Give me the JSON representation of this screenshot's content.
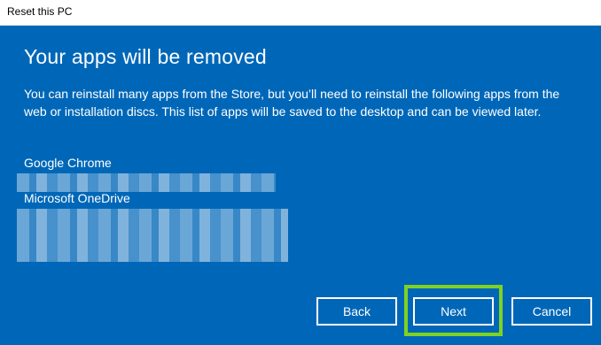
{
  "window": {
    "title": "Reset this PC"
  },
  "dialog": {
    "heading": "Your apps will be removed",
    "description": "You can reinstall many apps from the Store, but you’ll need to reinstall the following apps from the web or installation discs. This list of apps will be saved to the desktop and can be viewed later.",
    "apps": [
      "Google Chrome",
      "Microsoft OneDrive"
    ]
  },
  "buttons": {
    "back": "Back",
    "next": "Next",
    "cancel": "Cancel"
  },
  "colors": {
    "background": "#0067b8",
    "text": "#ffffff",
    "highlight": "#7ed321"
  }
}
